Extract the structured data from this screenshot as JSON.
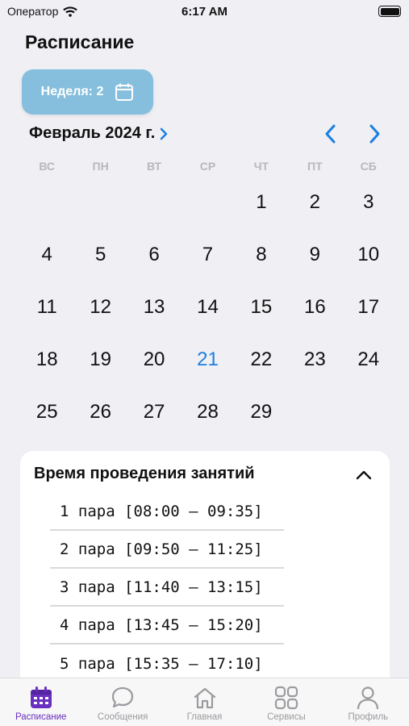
{
  "status_bar": {
    "carrier": "Оператор",
    "time": "6:17 AM"
  },
  "header": {
    "title": "Расписание"
  },
  "week_button": {
    "label": "Неделя: 2",
    "icon": "calendar-icon"
  },
  "calendar": {
    "month_label": "Февраль 2024 г.",
    "weekdays": [
      "ВС",
      "ПН",
      "ВТ",
      "СР",
      "ЧТ",
      "ПТ",
      "СБ"
    ],
    "weeks": [
      [
        "",
        "",
        "",
        "",
        "1",
        "2",
        "3"
      ],
      [
        "4",
        "5",
        "6",
        "7",
        "8",
        "9",
        "10"
      ],
      [
        "11",
        "12",
        "13",
        "14",
        "15",
        "16",
        "17"
      ],
      [
        "18",
        "19",
        "20",
        "21",
        "22",
        "23",
        "24"
      ],
      [
        "25",
        "26",
        "27",
        "28",
        "29",
        "",
        ""
      ]
    ],
    "today": "21",
    "accent_color": "#1a7fe0"
  },
  "class_times": {
    "title": "Время проведения занятий",
    "periods": [
      "1 пара [08:00 – 09:35]",
      "2 пара [09:50 – 11:25]",
      "3 пара [11:40 – 13:15]",
      "4 пара [13:45 – 15:20]",
      "5 пара [15:35 – 17:10]"
    ]
  },
  "tab_bar": {
    "active_color": "#6a2fc0",
    "tabs": [
      {
        "label": "Расписание",
        "icon": "calendar-icon",
        "active": true
      },
      {
        "label": "Сообщения",
        "icon": "message-icon",
        "active": false
      },
      {
        "label": "Главная",
        "icon": "home-icon",
        "active": false
      },
      {
        "label": "Сервисы",
        "icon": "grid-icon",
        "active": false
      },
      {
        "label": "Профиль",
        "icon": "person-icon",
        "active": false
      }
    ]
  }
}
